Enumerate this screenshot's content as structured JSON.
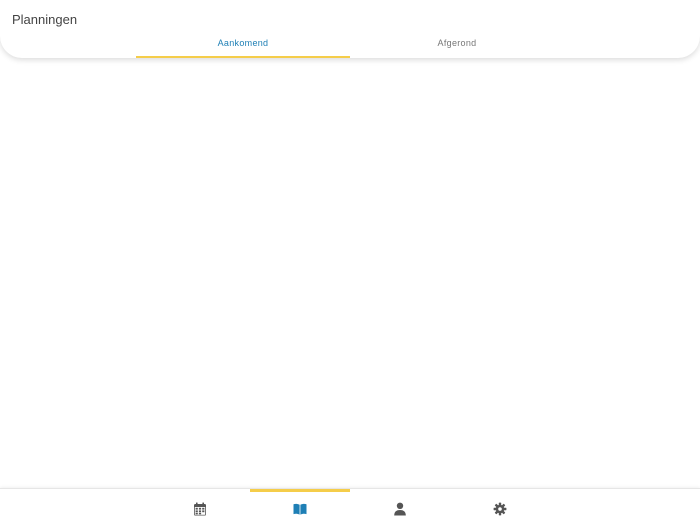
{
  "header": {
    "title": "Planningen"
  },
  "tabs": [
    {
      "label": "Aankomend",
      "active": true
    },
    {
      "label": "Afgerond",
      "active": false
    }
  ],
  "bottom_nav": {
    "items": [
      {
        "icon": "calendar-icon",
        "active": false
      },
      {
        "icon": "book-icon",
        "active": true
      },
      {
        "icon": "user-icon",
        "active": false
      },
      {
        "icon": "gear-icon",
        "active": false
      }
    ]
  },
  "colors": {
    "accent": "#f5cd4a",
    "active_tab_text": "#1e7fb5",
    "inactive_icon": "#555555",
    "active_icon": "#1e7fb5"
  }
}
